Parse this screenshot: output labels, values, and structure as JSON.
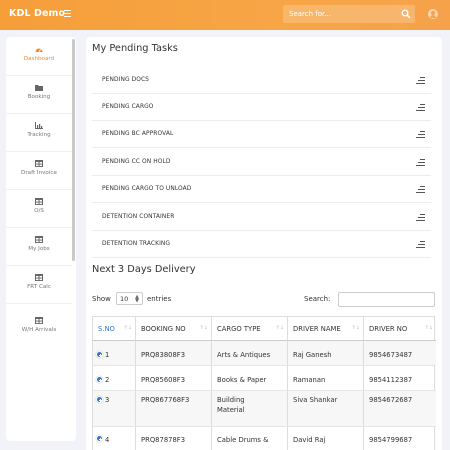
{
  "app": {
    "brand": "KDL Demo"
  },
  "search": {
    "placeholder": "Search for..."
  },
  "sidebar": {
    "items": [
      {
        "label": "Dashboard",
        "icon": "dashboard-icon",
        "active": true
      },
      {
        "label": "Booking",
        "icon": "folder-icon"
      },
      {
        "label": "Tracking",
        "icon": "chart-icon"
      },
      {
        "label": "Draft Invoice",
        "icon": "table-icon"
      },
      {
        "label": "O/S",
        "icon": "table-icon"
      },
      {
        "label": "My Jobs",
        "icon": "table-icon"
      },
      {
        "label": "FRT Calc",
        "icon": "table-icon"
      },
      {
        "label": "W/H Arrivals",
        "icon": "table-icon"
      }
    ]
  },
  "tasks": {
    "title": "My Pending Tasks",
    "items": [
      "PENDING DOCS",
      "PENDING CARGO",
      "PENDING BC APPROVAL",
      "PENDING CC ON HOLD",
      "PENDING CARGO TO UNLOAD",
      "DETENTION CONTAINER",
      "DETENTION TRACKING"
    ]
  },
  "delivery": {
    "title": "Next 3 Days Delivery",
    "show_label": "Show",
    "entries_value": "10",
    "entries_label": "entries",
    "search_label": "Search:",
    "columns": [
      "S.NO",
      "BOOKING NO",
      "CARGO TYPE",
      "DRIVER NAME",
      "DRIVER NO"
    ],
    "rows": [
      {
        "sno": "1",
        "booking": "PRQ83808F3",
        "cargo": "Arts & Antiques",
        "driver": "Raj Ganesh",
        "phone": "9854673487"
      },
      {
        "sno": "2",
        "booking": "PRQ85608F3",
        "cargo": "Books & Paper",
        "driver": "Ramanan",
        "phone": "9854112387"
      },
      {
        "sno": "3",
        "booking": "PRQ867768F3",
        "cargo": "Building Material",
        "driver": "Siva Shankar",
        "phone": "9854672687"
      },
      {
        "sno": "4",
        "booking": "PRQ87878F3",
        "cargo": "Cable Drums &",
        "driver": "David Raj",
        "phone": "9854799687"
      }
    ]
  },
  "colors": {
    "accent": "#f59e3a",
    "link": "#3378d1"
  }
}
